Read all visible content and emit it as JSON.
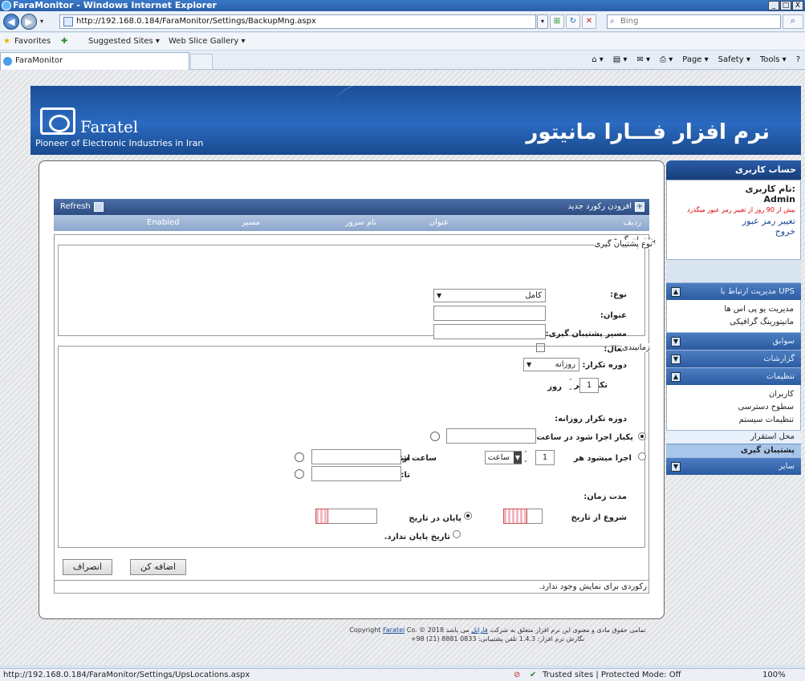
{
  "window": {
    "title": "FaraMonitor - Windows Internet Explorer",
    "buttons": [
      "_",
      "□",
      "X"
    ]
  },
  "address_bar": {
    "url": "http://192.168.0.184/FaraMonitor/Settings/BackupMng.aspx",
    "search_placeholder": "Bing"
  },
  "favorites_bar": {
    "favorites": "Favorites",
    "suggested": "Suggested Sites ▾",
    "webslice": "Web Slice Gallery ▾"
  },
  "tab": {
    "title": "FaraMonitor"
  },
  "command_bar": {
    "page": "Page ▾",
    "safety": "Safety ▾",
    "tools": "Tools ▾",
    "help": "?"
  },
  "banner": {
    "brand": "Faratel",
    "tagline": "Pioneer of Electronic Industries in Iran",
    "title": "نرم افزار فـــارا مانیتور"
  },
  "sidebar": {
    "account_header": "حساب کاربری",
    "username_label": "نام کاربری:",
    "username": "Admin",
    "password_warning": "بیش از 90 روز از تغییر رمز عبور میگذرد",
    "change_password": "تغییر رمز عبور",
    "logout": "خروج",
    "sections": [
      {
        "title": "مدیریت ارتباط با UPS",
        "items": [
          "مدیریت یو پی اس ها",
          "مانیتورینگ گرافیکی"
        ]
      },
      {
        "title": "سوابق"
      },
      {
        "title": "گزارشات"
      },
      {
        "title": "تنظیمات",
        "items": [
          "کاربران",
          "سطوح دسترسی",
          "تنظیمات سیستم"
        ]
      },
      {
        "title": "سایر"
      }
    ],
    "selected_item": "محل استقرار",
    "active_item": "پشتیبان گیری"
  },
  "toolbar": {
    "refresh": "Refresh",
    "add_new": "افزودن رکورد جدید"
  },
  "grid": {
    "columns": [
      "ردیف",
      "عنوان",
      "نام سرور",
      "مسیر",
      "Enabled"
    ]
  },
  "form": {
    "legend": "پشتیبان گیری",
    "type_legend": "نوع پشتیبان گیری",
    "type_label": "نوع:",
    "type_value": "کامل",
    "title_label": "عنوان:",
    "path_label": "مسیر پشتیبان گیری:",
    "active_label": "فعال:",
    "schedule_legend": "زمانبندی",
    "period_label": "دوره تکرار:",
    "period_value": "روزانه",
    "repeat_every": "تکرار هر",
    "repeat_value": "1",
    "repeat_unit": "روز",
    "daily_header": "دوره تکرار روزانه:",
    "once_at": "یکبار اجرا شود در ساعت",
    "runs_every": "اجرا میشود هر",
    "runs_value": "1",
    "runs_unit": "ساعت",
    "start_time": "ساعت شروع",
    "from": "از:",
    "to": "تا:",
    "duration": "مدت زمان:",
    "start_date": "شروع از تاریخ",
    "end_date": "پایان در تاریخ",
    "no_end": "تاریخ پایان ندارد.",
    "add_button": "اضافه کن",
    "cancel_button": "انصراف"
  },
  "no_records": "رکوردی برای نمایش وجود ندارد.",
  "footer": {
    "line1_fa": "تمامی حقوق مادی و معنوی این نرم افزار متعلق به شرکت",
    "company_link": "فاراتل",
    "line1_end": "می باشد",
    "copyright_en": "Copyright",
    "company_en": "Faratel",
    "copyright_tail": "Co. © 2018",
    "line2": "نگارش نرم افزار: 1.4.3  تلفن پشتیبانی: 0833 8881 (21) 98+"
  },
  "status_bar": {
    "url": "http://192.168.0.184/FaraMonitor/Settings/UpsLocations.aspx",
    "zone": "Trusted sites | Protected Mode: Off",
    "zoom": "100%"
  }
}
